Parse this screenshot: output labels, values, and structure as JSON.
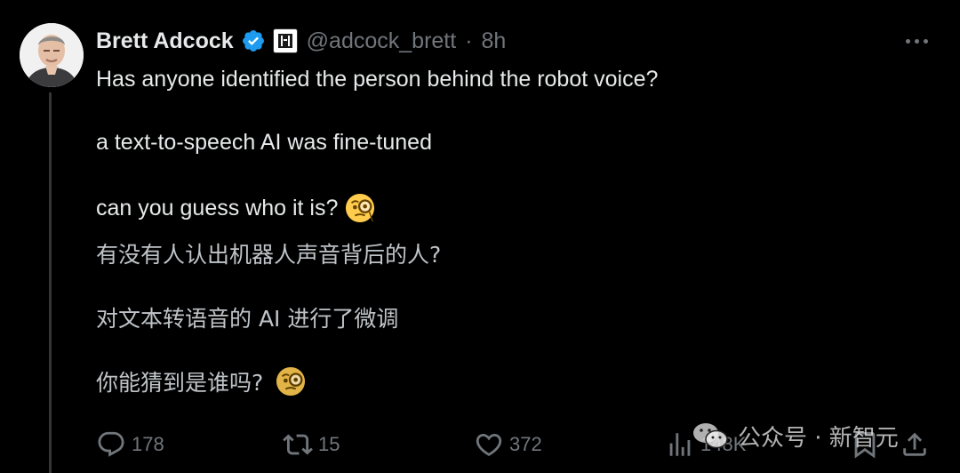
{
  "tweet": {
    "display_name": "Brett Adcock",
    "handle": "@adcock_brett",
    "separator": "·",
    "time": "8h",
    "lines_en": [
      "Has anyone identified the person behind the robot voice?",
      "a text-to-speech AI was fine-tuned",
      "can you guess who it is?"
    ],
    "lines_zh": [
      "有没有人认出机器人声音背后的人?",
      "对文本转语音的 AI 进行了微调",
      "你能猜到是谁吗?"
    ],
    "emoji": "face-with-monocle"
  },
  "actions": {
    "replies": "178",
    "reposts": "15",
    "likes": "372",
    "views": "148K"
  },
  "watermark": {
    "text": "公众号 · 新智元"
  },
  "colors": {
    "background": "#000000",
    "text": "#e7e9ea",
    "secondary": "#71767b",
    "verified": "#1d9bf0"
  }
}
